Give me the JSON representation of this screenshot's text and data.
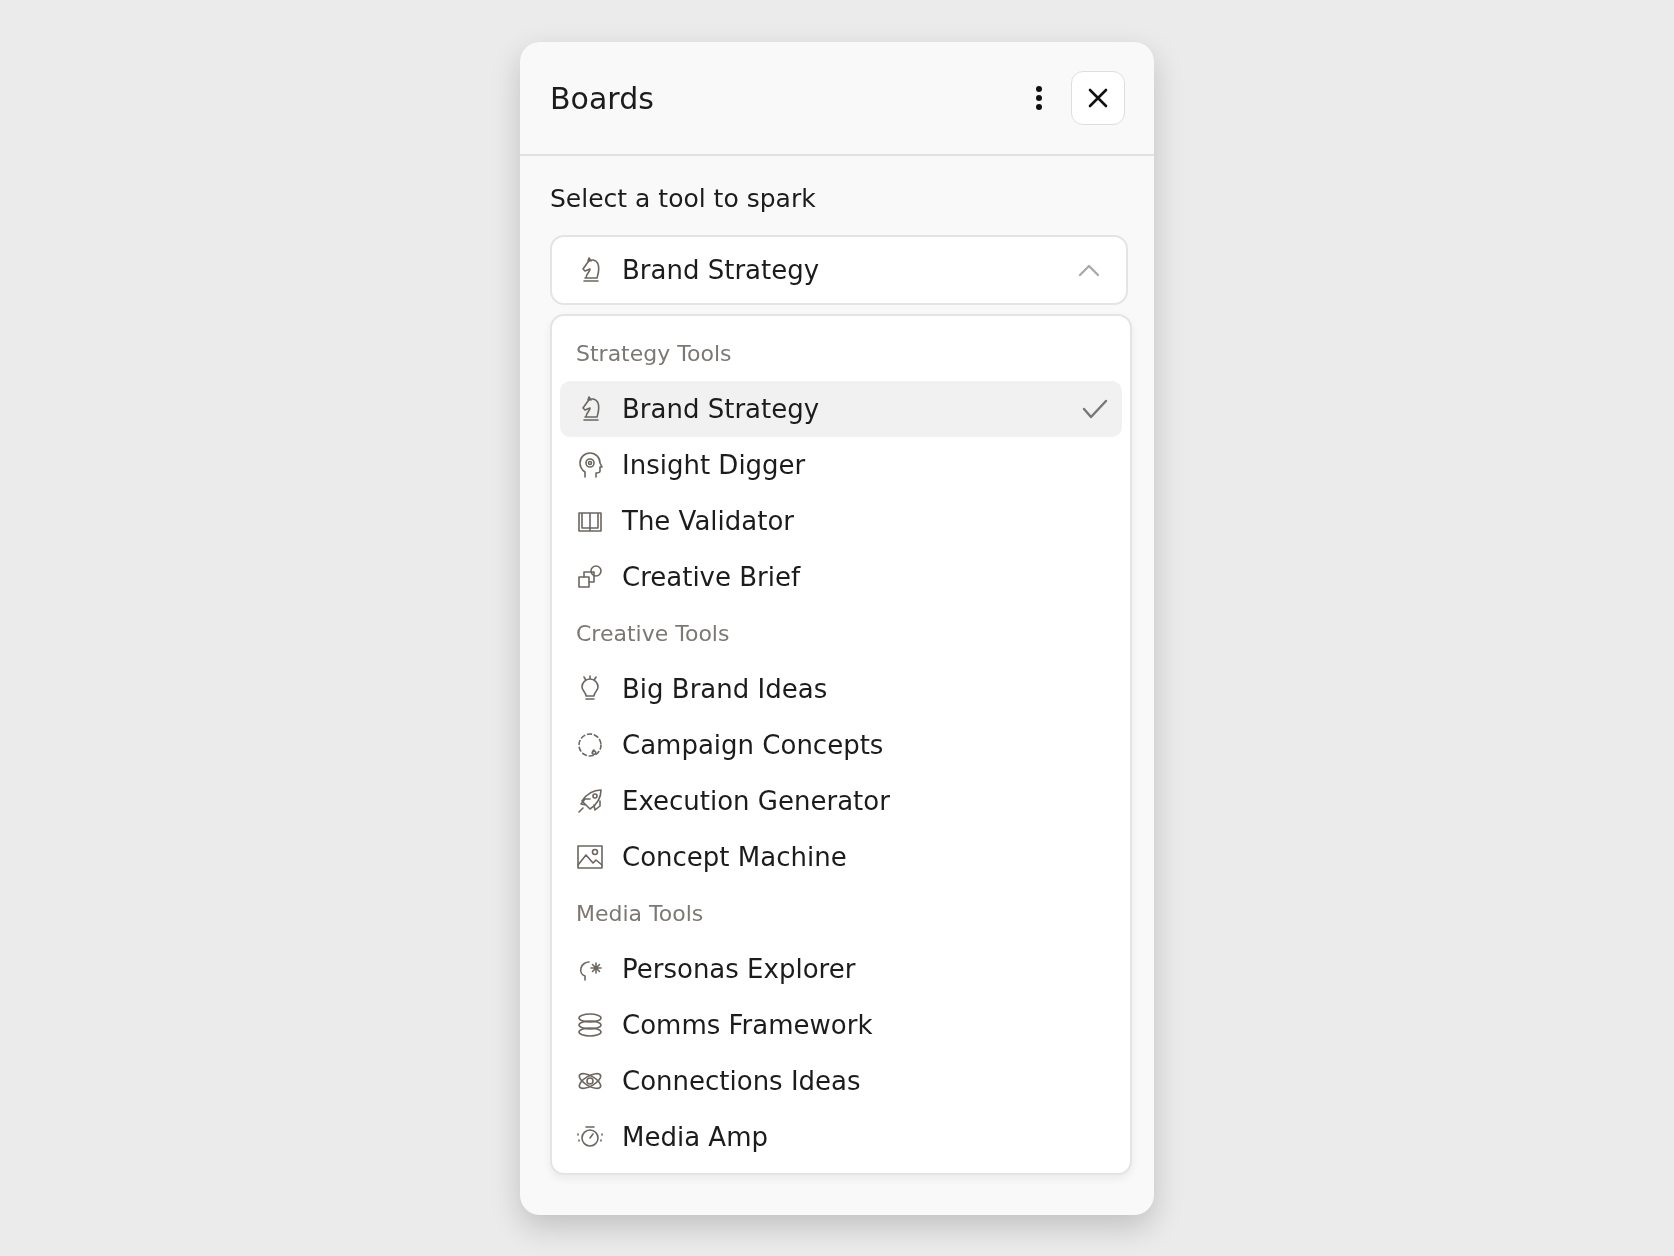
{
  "panel": {
    "title": "Boards"
  },
  "prompt": "Select a tool to spark",
  "select": {
    "value": "Brand Strategy",
    "expanded": true
  },
  "groups": [
    {
      "label": "Strategy Tools",
      "items": [
        {
          "label": "Brand Strategy",
          "selected": true
        },
        {
          "label": "Insight Digger",
          "selected": false
        },
        {
          "label": "The Validator",
          "selected": false
        },
        {
          "label": "Creative Brief",
          "selected": false
        }
      ]
    },
    {
      "label": "Creative Tools",
      "items": [
        {
          "label": "Big Brand Ideas",
          "selected": false
        },
        {
          "label": "Campaign Concepts",
          "selected": false
        },
        {
          "label": "Execution Generator",
          "selected": false
        },
        {
          "label": "Concept Machine",
          "selected": false
        }
      ]
    },
    {
      "label": "Media Tools",
      "items": [
        {
          "label": "Personas Explorer",
          "selected": false
        },
        {
          "label": "Comms Framework",
          "selected": false
        },
        {
          "label": "Connections Ideas",
          "selected": false
        },
        {
          "label": "Media Amp",
          "selected": false
        }
      ]
    }
  ]
}
